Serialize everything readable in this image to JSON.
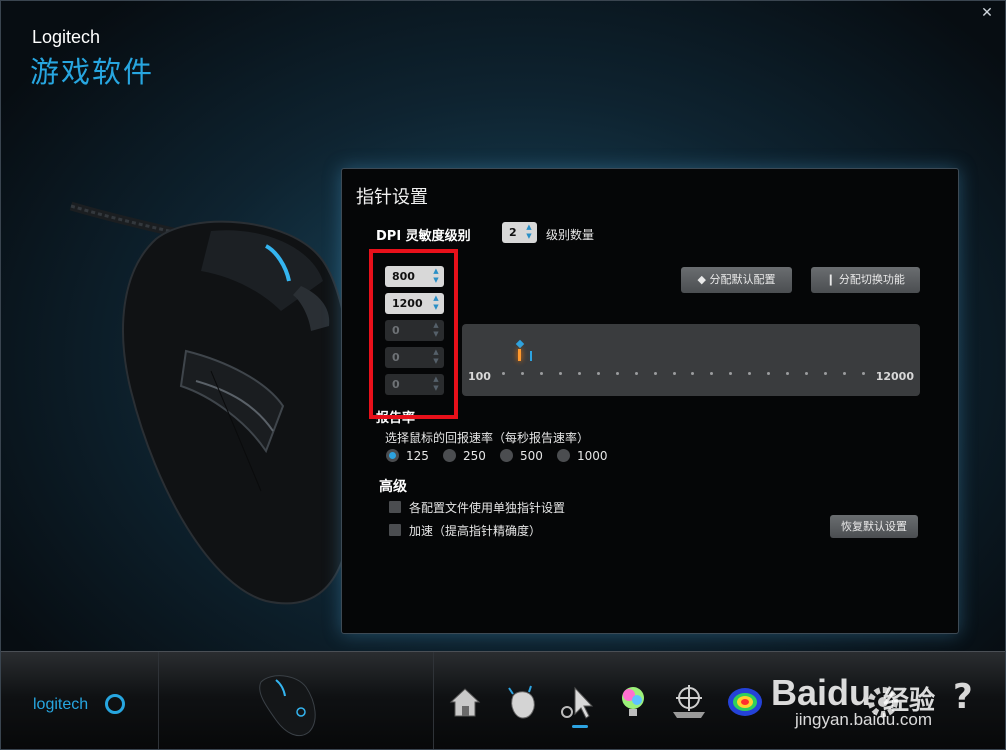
{
  "window": {
    "close_glyph": "✕"
  },
  "header": {
    "brand": "Logitech",
    "product": "游戏软件"
  },
  "panel": {
    "title": "指针设置",
    "dpi_label": "DPI 灵敏度级别",
    "level_count": {
      "value": "2",
      "label": "级别数量"
    },
    "dpi_levels": [
      {
        "value": "800",
        "enabled": true
      },
      {
        "value": "1200",
        "enabled": true
      },
      {
        "value": "0",
        "enabled": false
      },
      {
        "value": "0",
        "enabled": false
      },
      {
        "value": "0",
        "enabled": false
      }
    ],
    "buttons": {
      "assign_default": "◆ 分配默认配置",
      "assign_shift": "❙ 分配切换功能",
      "restore_default": "恢复默认设置"
    },
    "slider": {
      "min_label": "100",
      "max_label": "12000",
      "min": 100,
      "max": 12000,
      "markers": [
        800,
        1200
      ],
      "dot_count": 20
    },
    "report_rate": {
      "label": "报告率",
      "description": "选择鼠标的回报速率（每秒报告速率）",
      "options": [
        "125",
        "250",
        "500",
        "1000"
      ],
      "selected": "125"
    },
    "advanced": {
      "label": "高级",
      "options": [
        {
          "label": "各配置文件使用单独指针设置",
          "checked": false
        },
        {
          "label": "加速（提高指针精确度）",
          "checked": false
        }
      ]
    }
  },
  "bottom_bar": {
    "logo_text": "logitech",
    "icons": [
      "home-icon",
      "mouse-buttons-icon",
      "pointer-settings-icon",
      "lighting-icon",
      "surface-tuning-icon",
      "heatmap-icon",
      "settings-gear-icon",
      "help-icon"
    ],
    "active_icon": "pointer-settings-icon",
    "help_glyph": "?"
  },
  "watermark": {
    "brand": "Bai",
    "brand_mid": "du",
    "suffix": "经验",
    "url": "jingyan.baidu.com"
  },
  "colors": {
    "accent": "#27a6e0",
    "highlight_box": "#e8101a",
    "marker_active": "#ff9a2e"
  }
}
